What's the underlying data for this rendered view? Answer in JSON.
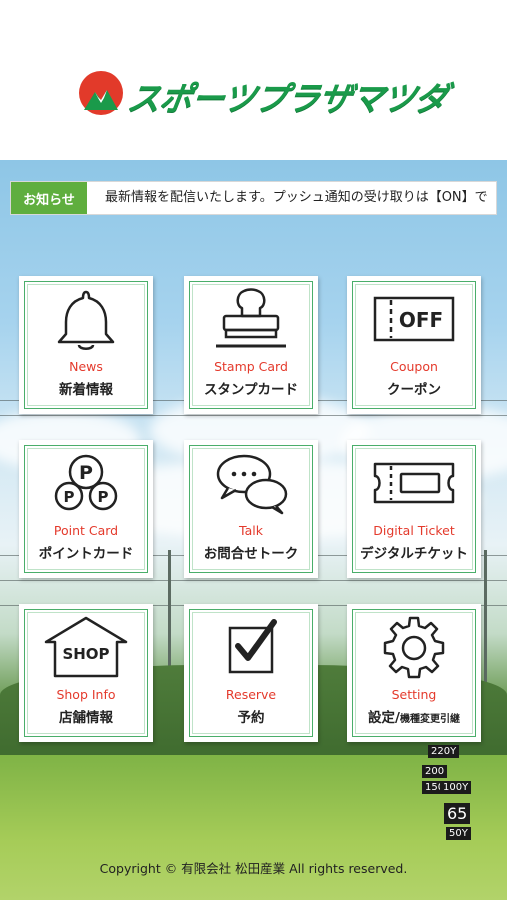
{
  "header": {
    "logo_text": "スポーツプラザマツダ"
  },
  "notice": {
    "badge": "お知らせ",
    "text": "最新情報を配信いたします。プッシュ通知の受け取りは【ON】で"
  },
  "menu": [
    {
      "en": "News",
      "ja": "新着情報",
      "icon": "bell-icon"
    },
    {
      "en": "Stamp Card",
      "ja": "スタンプカード",
      "icon": "stamp-icon"
    },
    {
      "en": "Coupon",
      "ja": "クーポン",
      "icon": "coupon-icon",
      "icon_text": "OFF"
    },
    {
      "en": "Point Card",
      "ja": "ポイントカード",
      "icon": "point-coins-icon",
      "icon_text": "P"
    },
    {
      "en": "Talk",
      "ja": "お問合せトーク",
      "icon": "chat-bubbles-icon"
    },
    {
      "en": "Digital Ticket",
      "ja": "デジタルチケット",
      "icon": "ticket-icon"
    },
    {
      "en": "Shop Info",
      "ja": "店舗情報",
      "icon": "shop-icon",
      "icon_text": "SHOP"
    },
    {
      "en": "Reserve",
      "ja": "予約",
      "icon": "checkbox-icon"
    },
    {
      "en": "Setting",
      "ja_main": "設定/",
      "ja_sub": "機種変更引継",
      "icon": "gear-icon"
    }
  ],
  "background_signs": [
    "220Y",
    "200",
    "150",
    "100Y",
    "65",
    "50Y"
  ],
  "footer": {
    "copyright": "Copyright © 有限会社 松田産業 All rights reserved."
  },
  "colors": {
    "brand_green": "#1a9a4a",
    "badge_green": "#5fae3e",
    "label_red": "#e43a2c",
    "logo_red": "#e23a2a"
  }
}
